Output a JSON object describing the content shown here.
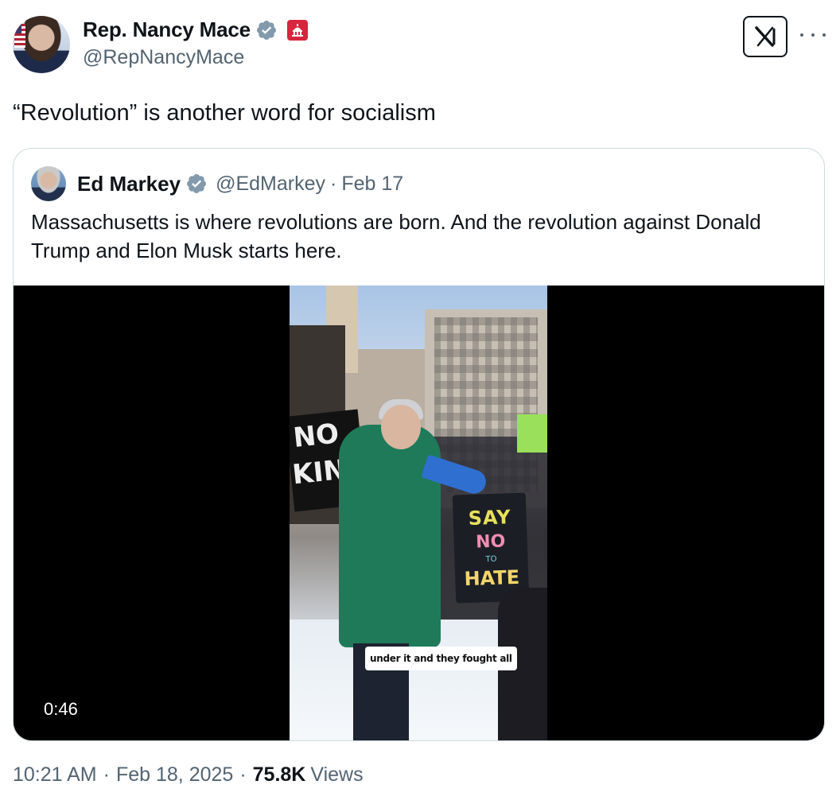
{
  "author": {
    "display_name": "Rep. Nancy Mace",
    "handle": "@RepNancyMace",
    "verified": true,
    "gov_badge_color": "#d7263d",
    "verified_color": "#829aab"
  },
  "tweet": {
    "text": "“Revolution” is another word for socialism"
  },
  "quoted": {
    "display_name": "Ed Markey",
    "handle": "@EdMarkey",
    "separator": "·",
    "date": "Feb 17",
    "text": "Massachusetts is where revolutions are born. And the revolution against Donald Trump and Elon Musk starts here.",
    "media": {
      "caption": "under it and they fought all",
      "duration": "0:46",
      "sign_lines": [
        "SAY",
        "NO",
        "TO",
        "HATE"
      ],
      "banner_text": [
        "NO",
        "KING"
      ]
    }
  },
  "footer": {
    "time": "10:21 AM",
    "separator": "·",
    "date": "Feb 18, 2025",
    "views_count": "75.8K",
    "views_label": "Views"
  },
  "icons": {
    "x_logo": "grok-icon",
    "more": "more-icon"
  }
}
